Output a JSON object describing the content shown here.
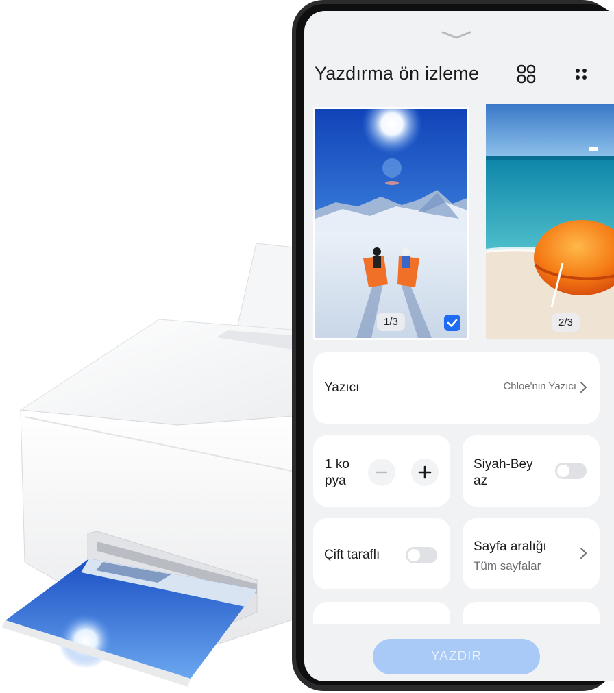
{
  "sheet": {
    "title": "Yazdırma ön izleme",
    "icons": [
      "chevron-down-icon",
      "grid-view-icon",
      "more-options-icon"
    ]
  },
  "previews": [
    {
      "page": "1/3",
      "selected": true
    },
    {
      "page": "2/3",
      "selected": false
    }
  ],
  "printer": {
    "label": "Yazıcı",
    "value": "Chloe'nin Yazıcı"
  },
  "copies": {
    "label": "1 ko pya",
    "count": 1
  },
  "blackwhite": {
    "label": "Siyah-Bey az",
    "on": false
  },
  "duplex": {
    "label": "Çift taraflı",
    "on": false
  },
  "page_range": {
    "label": "Sayfa aralığı",
    "value": "Tüm sayfalar"
  },
  "actions": {
    "print_label": "YAZDIR"
  },
  "colors": {
    "accent": "#1f6bf2",
    "print_button": "#a9c9f7",
    "background": "#f1f2f4"
  }
}
